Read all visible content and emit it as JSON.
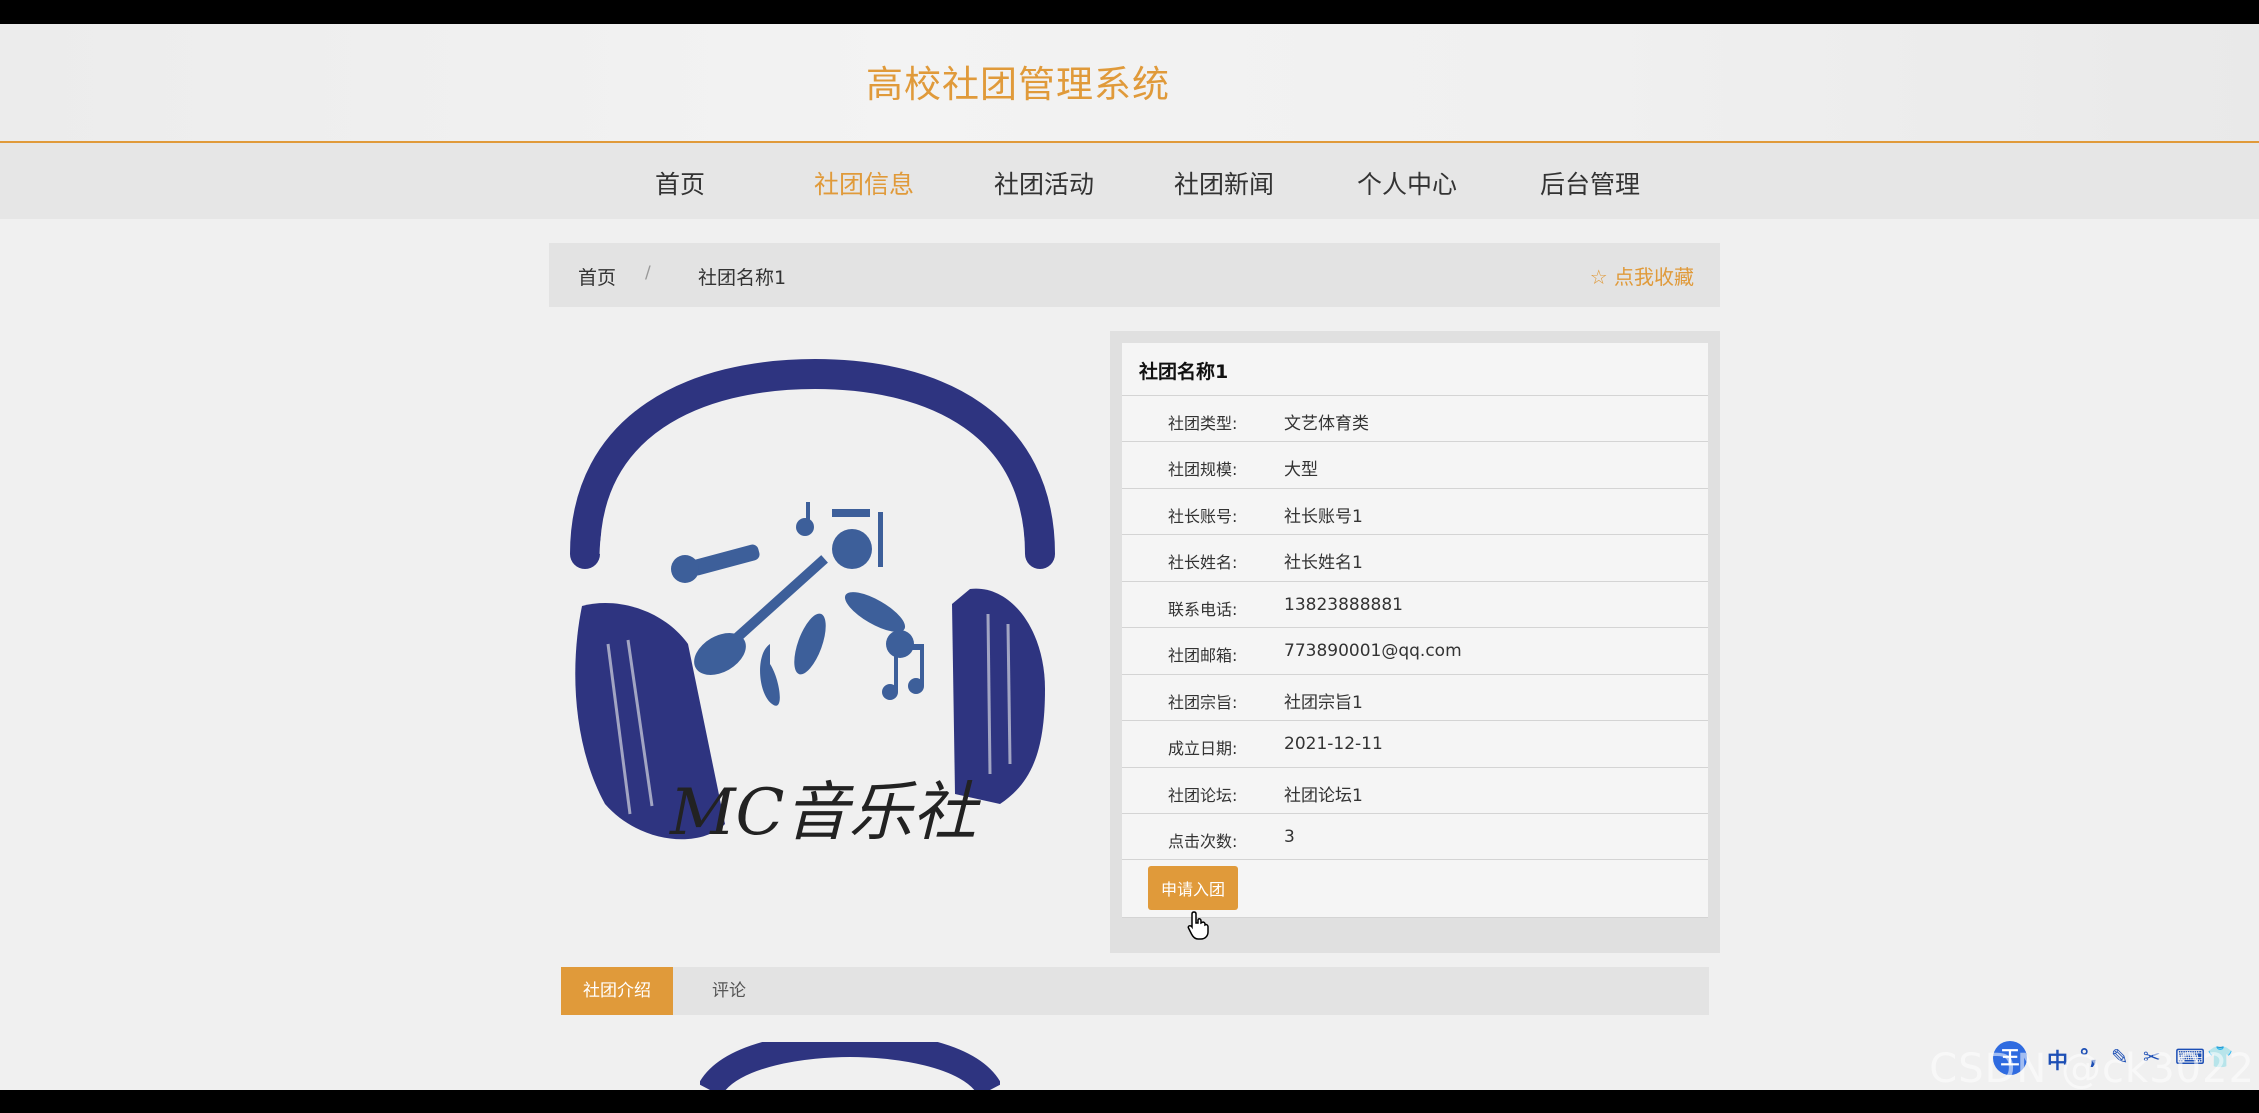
{
  "site": {
    "title": "高校社团管理系统"
  },
  "nav": {
    "items": [
      {
        "label": "首页"
      },
      {
        "label": "社团信息",
        "active": true
      },
      {
        "label": "社团活动"
      },
      {
        "label": "社团新闻"
      },
      {
        "label": "个人中心"
      },
      {
        "label": "后台管理"
      }
    ]
  },
  "breadcrumb": {
    "home": "首页",
    "separator": "/",
    "current": "社团名称1"
  },
  "favorite": {
    "label": "点我收藏",
    "icon": "star-outline-icon"
  },
  "logo": {
    "text": "MC音乐社",
    "color": "#2e3480"
  },
  "club": {
    "name": "社团名称1",
    "fields": [
      {
        "label": "社团类型:",
        "value": "文艺体育类"
      },
      {
        "label": "社团规模:",
        "value": "大型"
      },
      {
        "label": "社长账号:",
        "value": "社长账号1"
      },
      {
        "label": "社长姓名:",
        "value": "社长姓名1"
      },
      {
        "label": "联系电话:",
        "value": "13823888881"
      },
      {
        "label": "社团邮箱:",
        "value": "773890001@qq.com"
      },
      {
        "label": "社团宗旨:",
        "value": "社团宗旨1"
      },
      {
        "label": "成立日期:",
        "value": "2021-12-11"
      },
      {
        "label": "社团论坛:",
        "value": "社团论坛1"
      },
      {
        "label": "点击次数:",
        "value": "3"
      }
    ],
    "apply_label": "申请入团"
  },
  "tabs": [
    {
      "label": "社团介绍",
      "active": true
    },
    {
      "label": "评论"
    }
  ],
  "ime": {
    "main": "王",
    "items": [
      "中",
      "°,",
      "✎",
      "✂",
      "⌨",
      "👕"
    ]
  },
  "watermark": "CSDN @ck3022",
  "colors": {
    "accent": "#e09a3a",
    "logo_blue": "#2e3480"
  }
}
